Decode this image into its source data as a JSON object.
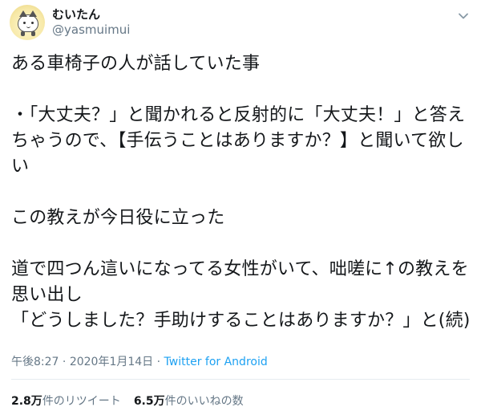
{
  "user": {
    "display_name": "むいたん",
    "handle": "@yasmuimui",
    "avatar_icon": "cat-avatar-icon"
  },
  "menu": {
    "icon": "chevron-down-icon"
  },
  "tweet": {
    "text": "ある車椅子の人が話していた事\n\n・「大丈夫？」と聞かれると反射的に「大丈夫！」と答えちゃうので、【手伝うことはありますか？】と聞いて欲しい\n\nこの教えが今日役に立った\n\n道で四つん這いになってる女性がいて、咄嗟に↑の教えを思い出し\n「どうしました？手助けすることはありますか？」と(続)"
  },
  "meta": {
    "time": "午後8:27",
    "sep1": " · ",
    "date": "2020年1月14日",
    "sep2": " · ",
    "source": "Twitter for Android"
  },
  "stats": {
    "retweets_count": "2.8万",
    "retweets_label": "件のリツイート",
    "likes_count": "6.5万",
    "likes_label": "件のいいねの数"
  },
  "colors": {
    "text": "#14171a",
    "secondary": "#657786",
    "link": "#1da1f2",
    "divider": "#e6ecf0"
  }
}
